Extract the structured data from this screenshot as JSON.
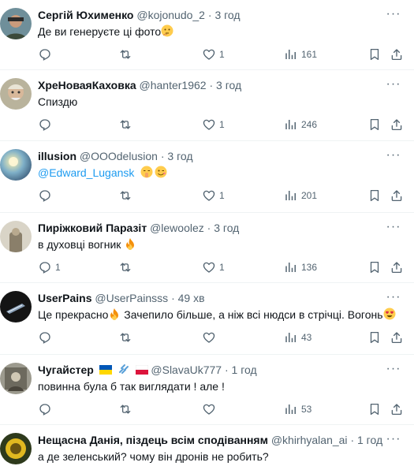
{
  "replies": [
    {
      "name": "Сергій Юхименко",
      "handle": "@kojonudo_2",
      "dot": "·",
      "time": "3 год",
      "text": "Де ви генеруєте ці фото",
      "reply_count": "",
      "retweet_count": "",
      "like_count": "1",
      "view_count": "161",
      "emojis": [
        "thinking-face"
      ]
    },
    {
      "name": "ХреНоваяКаховка",
      "handle": "@hanter1962",
      "dot": "·",
      "time": "3 год",
      "text": "Спиздю",
      "reply_count": "",
      "retweet_count": "",
      "like_count": "1",
      "view_count": "246"
    },
    {
      "name": "illusion",
      "handle": "@OOOdelusion",
      "dot": "·",
      "time": "3 год",
      "mention": "@Edward_Lugansk",
      "reply_count": "",
      "retweet_count": "",
      "like_count": "1",
      "view_count": "201",
      "emojis": [
        "shushing-face",
        "winking-face"
      ]
    },
    {
      "name": "Пиріжковий Паразіт",
      "handle": "@lewoolez",
      "dot": "·",
      "time": "3 год",
      "text": "в духовці вогник",
      "reply_count": "1",
      "retweet_count": "",
      "like_count": "1",
      "view_count": "136",
      "emojis": [
        "fire"
      ]
    },
    {
      "name": "UserPains",
      "handle": "@UserPainsss",
      "dot": "·",
      "time": "49 хв",
      "text_a": "Це прекрасно",
      "text_b": " Зачепило більше, а ніж всі нюдси в стрічці. Вогонь",
      "reply_count": "",
      "retweet_count": "",
      "like_count": "",
      "view_count": "43",
      "emojis": [
        "fire",
        "heart-eyes-face"
      ]
    },
    {
      "name": "Чугайстер",
      "handle": "@SlavaUk777",
      "dot": "·",
      "time": "1 год",
      "text": "повинна була б так виглядати ! але !",
      "reply_count": "",
      "retweet_count": "",
      "like_count": "",
      "view_count": "53",
      "flags": [
        "ukraine-flag",
        "link-chain",
        "poland-flag"
      ]
    },
    {
      "name": "Нещасна Данія, піздець всім сподіванням",
      "handle": "@khirhyalan_ai",
      "dot": "·",
      "time": "1 год",
      "text": "а де зеленський? чому він дронів не робить?"
    }
  ],
  "icons": [
    "more-icon",
    "reply-icon",
    "retweet-icon",
    "like-icon",
    "views-icon",
    "bookmark-icon",
    "share-icon"
  ],
  "colors": {
    "text": "#0f1419",
    "secondary": "#536471",
    "link": "#1d9bf0",
    "divider": "#eff3f4"
  }
}
